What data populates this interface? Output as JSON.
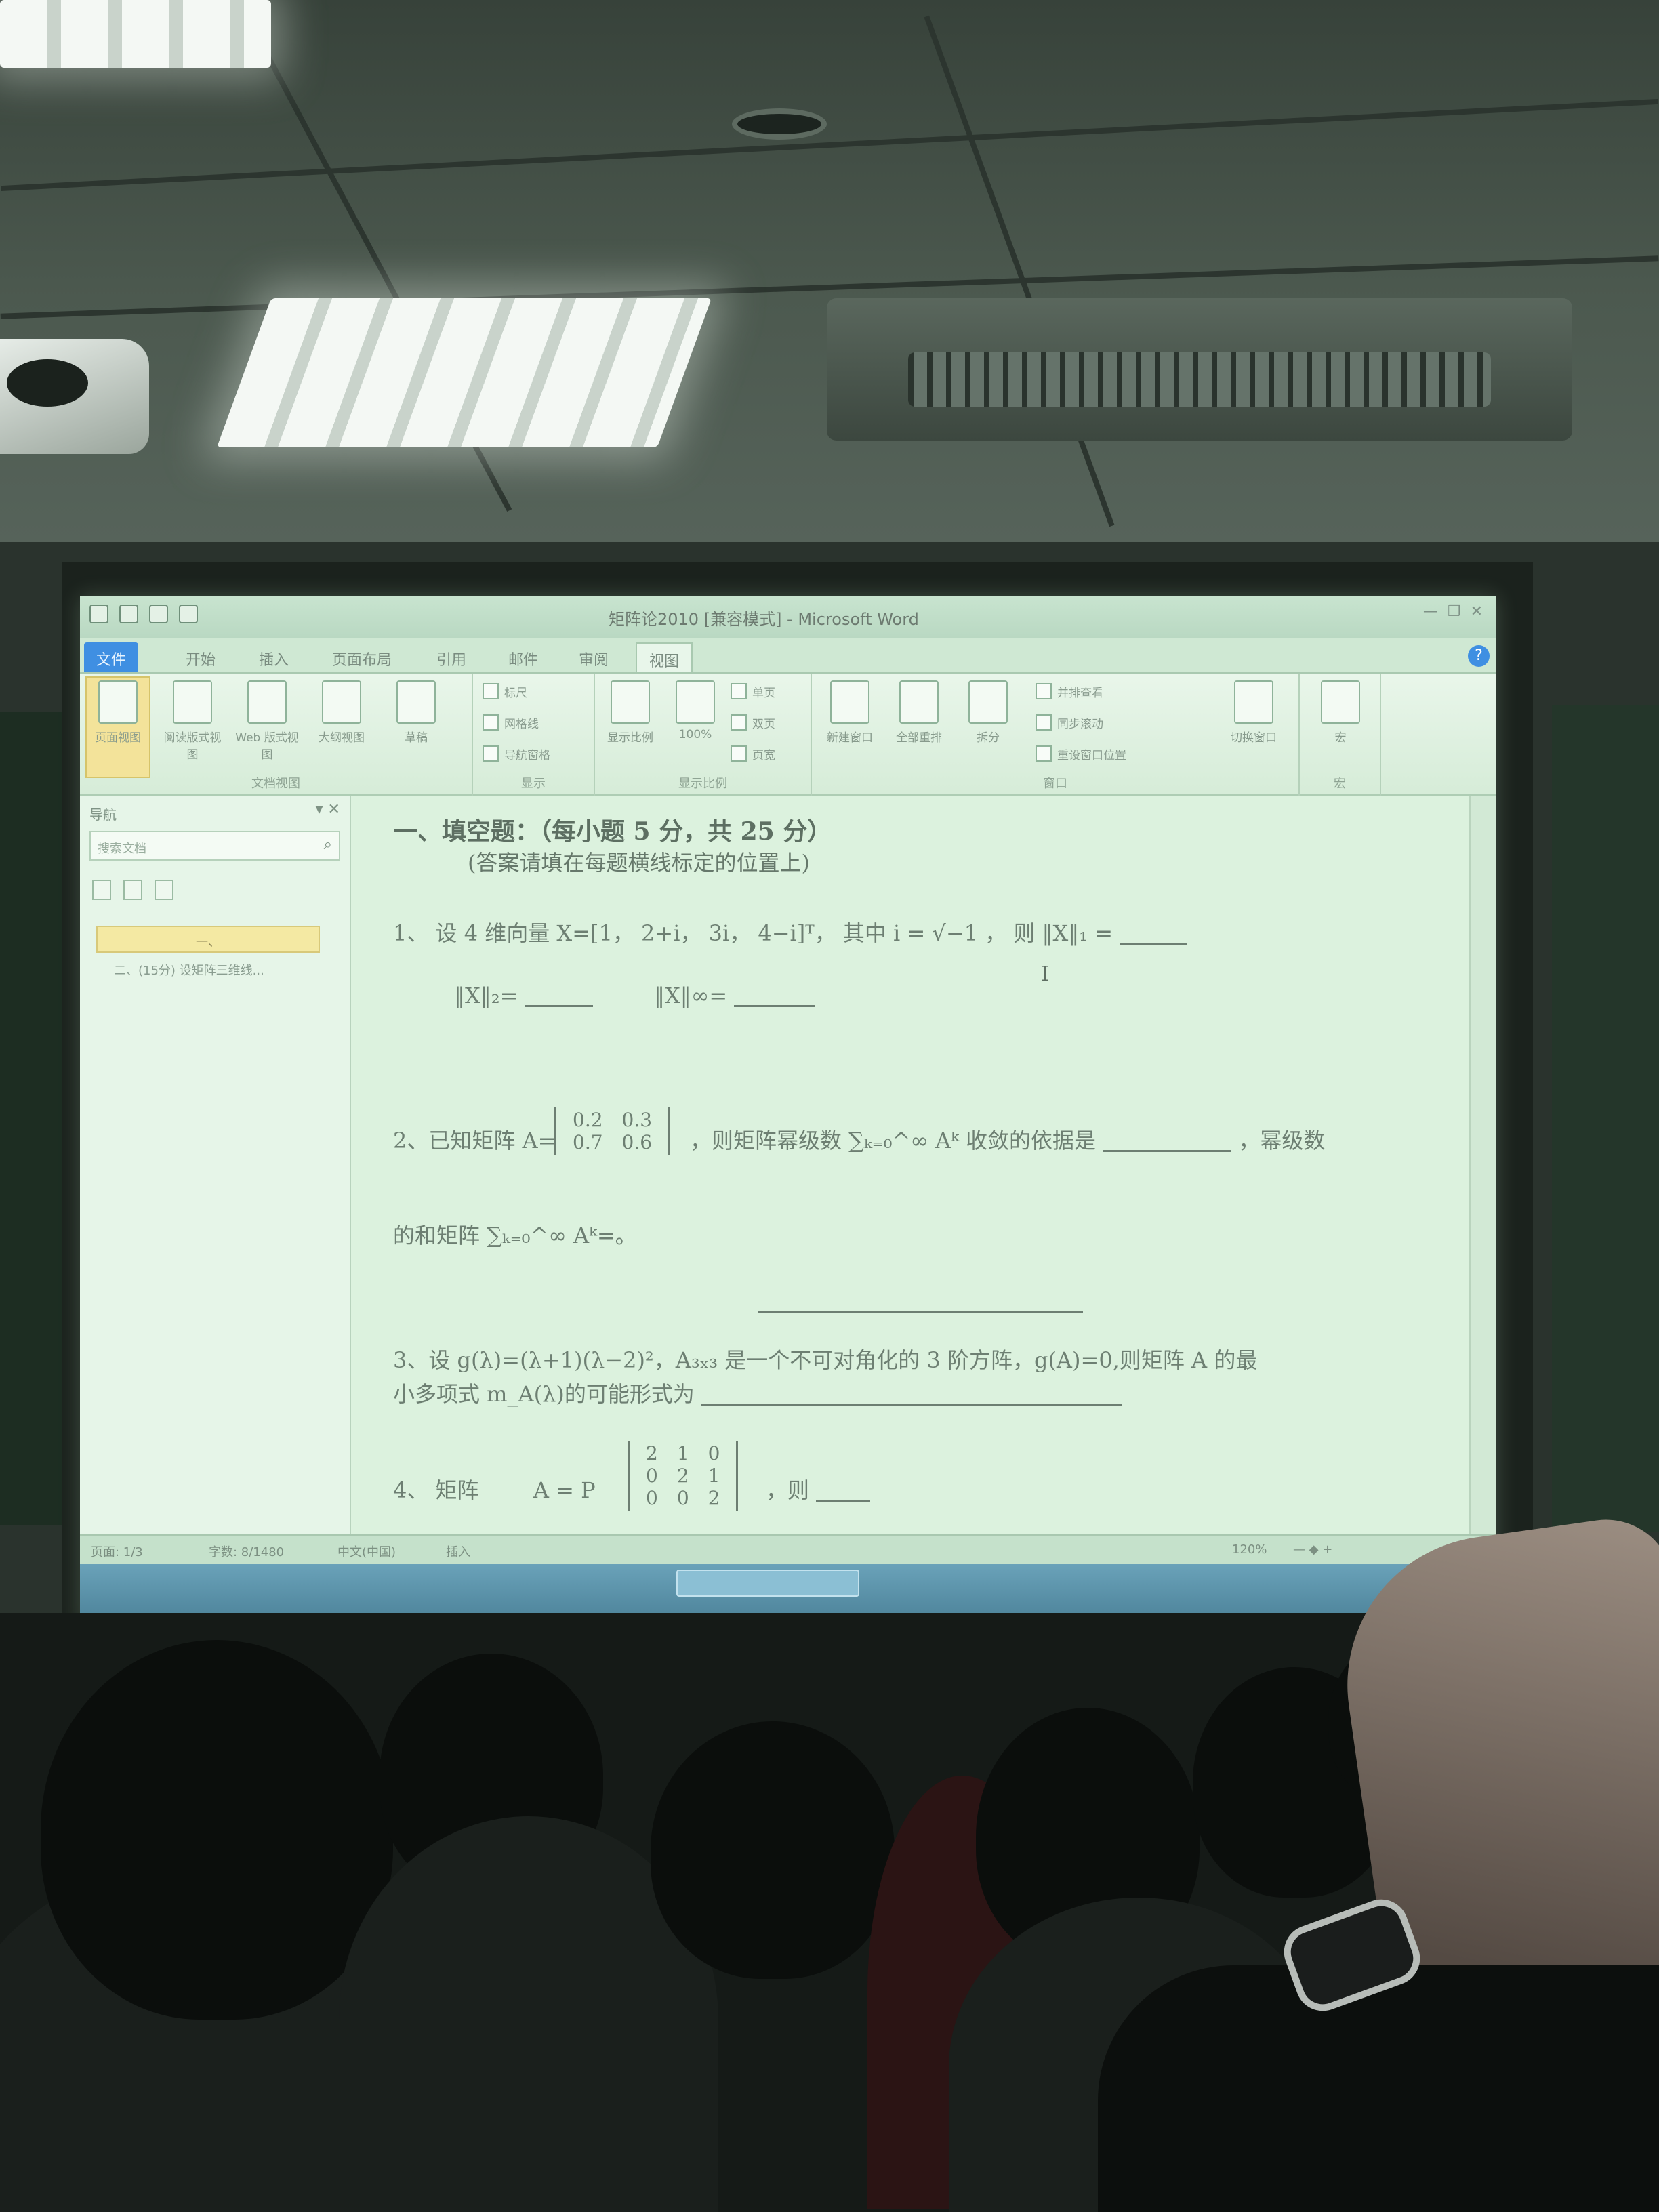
{
  "window": {
    "title": "矩阵论2010 [兼容模式] - Microsoft Word",
    "controls": [
      "—",
      "❐",
      "✕"
    ]
  },
  "ribbon": {
    "tabs": [
      {
        "label": "文件",
        "state": "file"
      },
      {
        "label": "开始",
        "state": ""
      },
      {
        "label": "插入",
        "state": ""
      },
      {
        "label": "页面布局",
        "state": ""
      },
      {
        "label": "引用",
        "state": ""
      },
      {
        "label": "邮件",
        "state": ""
      },
      {
        "label": "审阅",
        "state": ""
      },
      {
        "label": "视图",
        "state": "active"
      }
    ],
    "groups": {
      "document_views": {
        "label": "文档视图",
        "buttons": [
          "页面视图",
          "阅读版式视图",
          "Web 版式视图",
          "大纲视图",
          "草稿"
        ]
      },
      "show": {
        "label": "显示",
        "items": [
          "标尺",
          "网格线",
          "导航窗格"
        ]
      },
      "zoom": {
        "label": "显示比例",
        "buttons": [
          "显示比例",
          "100%"
        ],
        "items": [
          "单页",
          "双页",
          "页宽"
        ]
      },
      "window": {
        "label": "窗口",
        "buttons": [
          "新建窗口",
          "全部重排",
          "拆分"
        ],
        "items": [
          "并排查看",
          "同步滚动",
          "重设窗口位置"
        ],
        "switch_label": "切换窗口"
      },
      "macros": {
        "label": "宏",
        "button": "宏"
      }
    }
  },
  "nav": {
    "title": "导航",
    "search_placeholder": "搜索文档",
    "headings": [
      "一、",
      "二、(15分) 设矩阵三维线..."
    ]
  },
  "document": {
    "section_title": "一、填空题：（每小题 5 分，共 25 分）",
    "section_note": "(答案请填在每题横线标定的位置上)",
    "q1": {
      "line1": "1、 设 4 维向量 X=[1， 2+i， 3i， 4−i]ᵀ， 其中 i = √−1 ， 则 ‖X‖₁ =",
      "norm2": "‖X‖₂=",
      "norm_inf": "‖X‖∞="
    },
    "q2": {
      "prefix": "2、已知矩阵 A=",
      "matrix": [
        [
          "0.2",
          "0.3"
        ],
        [
          "0.7",
          "0.6"
        ]
      ],
      "text": "，则矩阵幂级数 ∑ₖ₌₀^∞ Aᵏ 收敛的依据是",
      "tail": "，幂级数",
      "line2": "的和矩阵 ∑ₖ₌₀^∞ Aᵏ=。"
    },
    "q3": {
      "line1": "3、设 g(λ)=(λ+1)(λ−2)²，A₃ₓ₃ 是一个不可对角化的 3 阶方阵，g(A)=0,则矩阵 A 的最",
      "line2": "小多项式 m_A(λ)的可能形式为"
    },
    "q4": {
      "prefix": "4、 矩阵",
      "lhs": "A = P",
      "matrix": [
        [
          "2",
          "1",
          "0"
        ],
        [
          "0",
          "2",
          "1"
        ],
        [
          "0",
          "0",
          "2"
        ]
      ],
      "tail": "，则"
    }
  },
  "status": {
    "page": "页面: 1/3",
    "words": "字数: 8/1480",
    "language": "中文(中国)",
    "mode": "插入",
    "zoom": "120%"
  }
}
